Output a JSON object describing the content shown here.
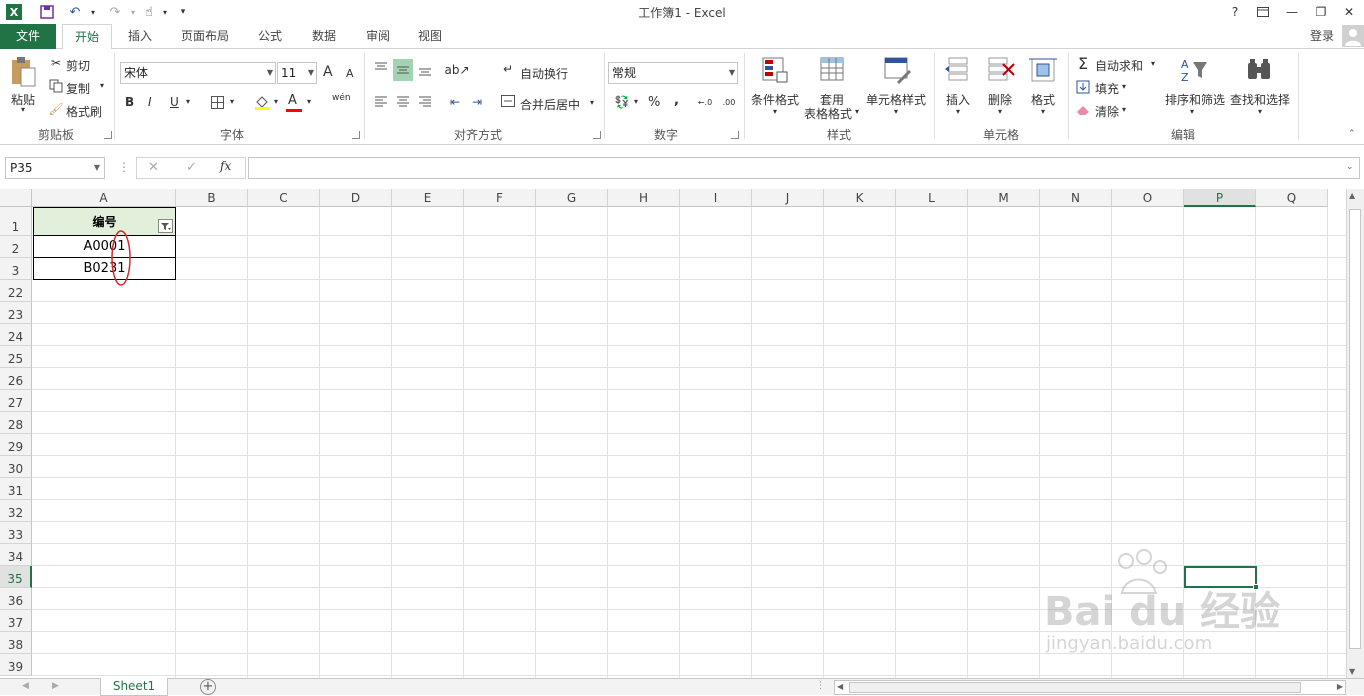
{
  "window": {
    "title": "工作簿1 - Excel",
    "help": "?",
    "login": "登录"
  },
  "tabs": [
    "文件",
    "开始",
    "插入",
    "页面布局",
    "公式",
    "数据",
    "审阅",
    "视图"
  ],
  "ribbon": {
    "clipboard": {
      "paste": "粘贴",
      "cut": "剪切",
      "copy": "复制",
      "format_painter": "格式刷",
      "label": "剪贴板"
    },
    "font": {
      "name": "宋体",
      "size": "11",
      "bold": "B",
      "italic": "I",
      "underline": "U",
      "label": "字体",
      "grow": "A",
      "shrink": "A",
      "color_glyph": "A",
      "phonetic": "wén"
    },
    "alignment": {
      "wrap": "自动换行",
      "merge": "合并后居中",
      "label": "对齐方式"
    },
    "number": {
      "format": "常规",
      "percent": "%",
      "comma": ",",
      "label": "数字"
    },
    "styles": {
      "conditional": "条件格式",
      "table_line1": "套用",
      "table_line2": "表格格式",
      "cell_styles": "单元格样式",
      "label": "样式"
    },
    "cells": {
      "insert": "插入",
      "delete": "删除",
      "format": "格式",
      "label": "单元格"
    },
    "editing": {
      "autosum": "自动求和",
      "fill": "填充",
      "clear": "清除",
      "sort": "排序和筛选",
      "find": "查找和选择",
      "label": "编辑"
    }
  },
  "formula_bar": {
    "name_box": "P35",
    "fx": "fx",
    "formula": ""
  },
  "columns": [
    "A",
    "B",
    "C",
    "D",
    "E",
    "F",
    "G",
    "H",
    "I",
    "J",
    "K",
    "L",
    "M",
    "N",
    "O",
    "P",
    "Q"
  ],
  "selected_column": "P",
  "rows": [
    "1",
    "2",
    "3",
    "22",
    "23",
    "24",
    "25",
    "26",
    "27",
    "28",
    "29",
    "30",
    "31",
    "32",
    "33",
    "34",
    "35",
    "36",
    "37",
    "38",
    "39"
  ],
  "selected_row": "35",
  "cells": {
    "A1": "编号",
    "A2": "A0001",
    "A3": "B0231"
  },
  "sheet": {
    "name": "Sheet1",
    "add": "+"
  },
  "watermark": {
    "brand": "Bai du 经验",
    "url": "jingyan.baidu.com"
  },
  "colors": {
    "excel_green": "#217346",
    "annotation_red": "#d42a2a",
    "header_fill": "#e2efda"
  }
}
